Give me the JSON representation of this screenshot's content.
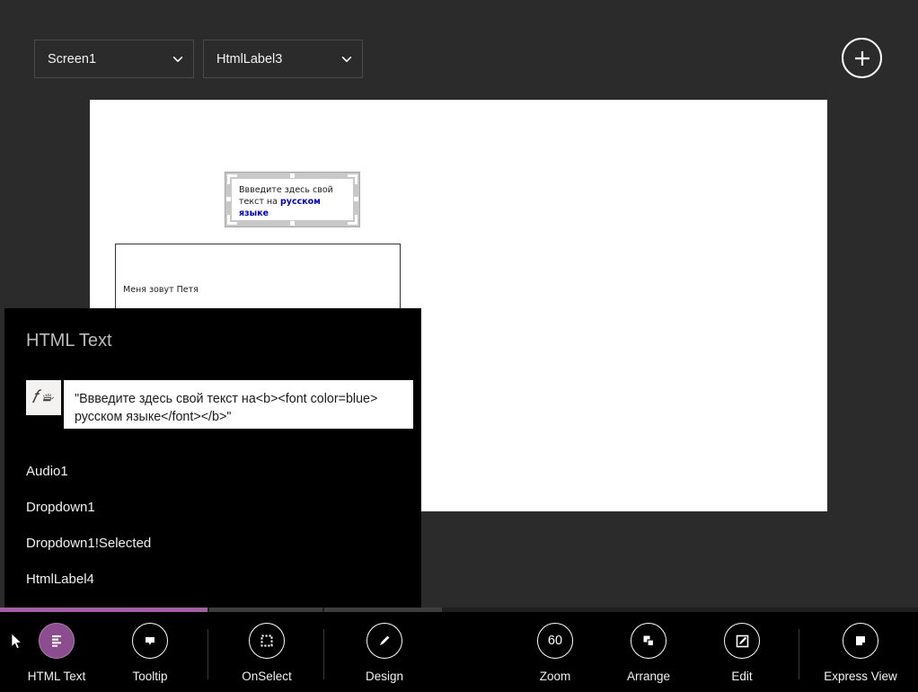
{
  "app": {
    "background_color": "#2b2b2b",
    "panel_color": "#000000",
    "accent_color": "#a25fa4"
  },
  "topbar": {
    "screen_dropdown": {
      "value": "Screen1",
      "icon": "chevron-down-icon"
    },
    "control_dropdown": {
      "value": "HtmlLabel3",
      "icon": "chevron-down-icon"
    },
    "add_button": {
      "label": "+",
      "icon": "plus-circle-icon"
    }
  },
  "canvas": {
    "html_label": {
      "text_plain": "Ввведите здесь свой текст на ",
      "text_bold_blue": "русском языке",
      "bold_color": "#0000cc"
    },
    "text_input": {
      "value": "Меня зовут Петя"
    }
  },
  "property_panel": {
    "title": "HTML Text",
    "fx_icon": "fx-icon",
    "formula_value": "\"Ввведите здесь свой текст на<b><font color=blue> русском языке</font></b>\"",
    "suggestions": [
      {
        "label": "Audio1"
      },
      {
        "label": "Dropdown1"
      },
      {
        "label": "Dropdown1!Selected"
      },
      {
        "label": "HtmlLabel4"
      }
    ]
  },
  "toolbar": {
    "items": [
      {
        "label": "HTML Text",
        "icon": "html-text-icon",
        "active": true
      },
      {
        "label": "Tooltip",
        "icon": "tooltip-icon",
        "active": false
      },
      {
        "label": "OnSelect",
        "icon": "onselect-icon",
        "active": false
      },
      {
        "label": "Design",
        "icon": "pencil-icon",
        "active": false
      },
      {
        "label": "Zoom",
        "icon": "zoom-icon",
        "active": false,
        "value": "60"
      },
      {
        "label": "Arrange",
        "icon": "arrange-icon",
        "active": false
      },
      {
        "label": "Edit",
        "icon": "edit-icon",
        "active": false
      },
      {
        "label": "Express View",
        "icon": "express-view-icon",
        "active": false
      }
    ]
  }
}
